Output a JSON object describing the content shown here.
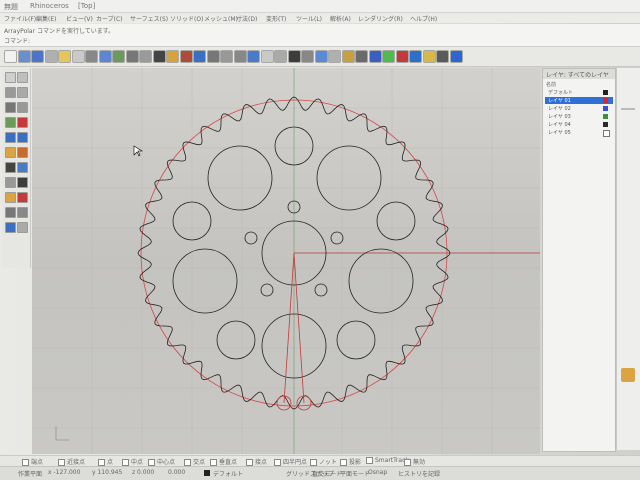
{
  "window": {
    "title_left": "無題",
    "title_app": "Rhinoceros",
    "title_view": "[Top]"
  },
  "menu": [
    "ファイル(F)",
    "編集(E)",
    "ビュー(V)",
    "カーブ(C)",
    "サーフェス(S)",
    "ソリッド(O)",
    "メッシュ(M)",
    "寸法(D)",
    "変形(T)",
    "ツール(L)",
    "解析(A)",
    "レンダリング(R)",
    "ヘルプ(H)"
  ],
  "command": {
    "history": "ArrayPolar コマンドを実行しています。",
    "prompt": "コマンド:"
  },
  "layers_panel": {
    "title": "レイヤ: すべてのレイヤ",
    "col_name": "名前",
    "rows": [
      {
        "name": "デフォルト",
        "color": "#222222"
      },
      {
        "name": "レイヤ 01",
        "color": "#d22a2a"
      },
      {
        "name": "レイヤ 02",
        "color": "#3b4fd8"
      },
      {
        "name": "レイヤ 03",
        "color": "#3f8f3f"
      },
      {
        "name": "レイヤ 04",
        "color": "#2a2a2a"
      },
      {
        "name": "レイヤ 05",
        "color": "#ffffff"
      }
    ]
  },
  "osnap": [
    "端点",
    "近接点",
    "点",
    "中点",
    "中心点",
    "交点",
    "垂直点",
    "接点",
    "四半円点",
    "ノット",
    "投影",
    "SmartTrack",
    "無効"
  ],
  "statusbar": {
    "plane": "作業平面",
    "x": "x -127.000",
    "y": "y 110.945",
    "z": "z 0.000",
    "distance": "0.000",
    "layer": "デフォルト",
    "grid_snap": "グリッドスナップ",
    "ortho": "直交モード",
    "planar": "平面モード",
    "osnap": "Osnap",
    "record": "ヒストリを記録"
  },
  "viewport": {
    "name": "Top",
    "gear_teeth": 40,
    "accent": "#d33a3a"
  }
}
